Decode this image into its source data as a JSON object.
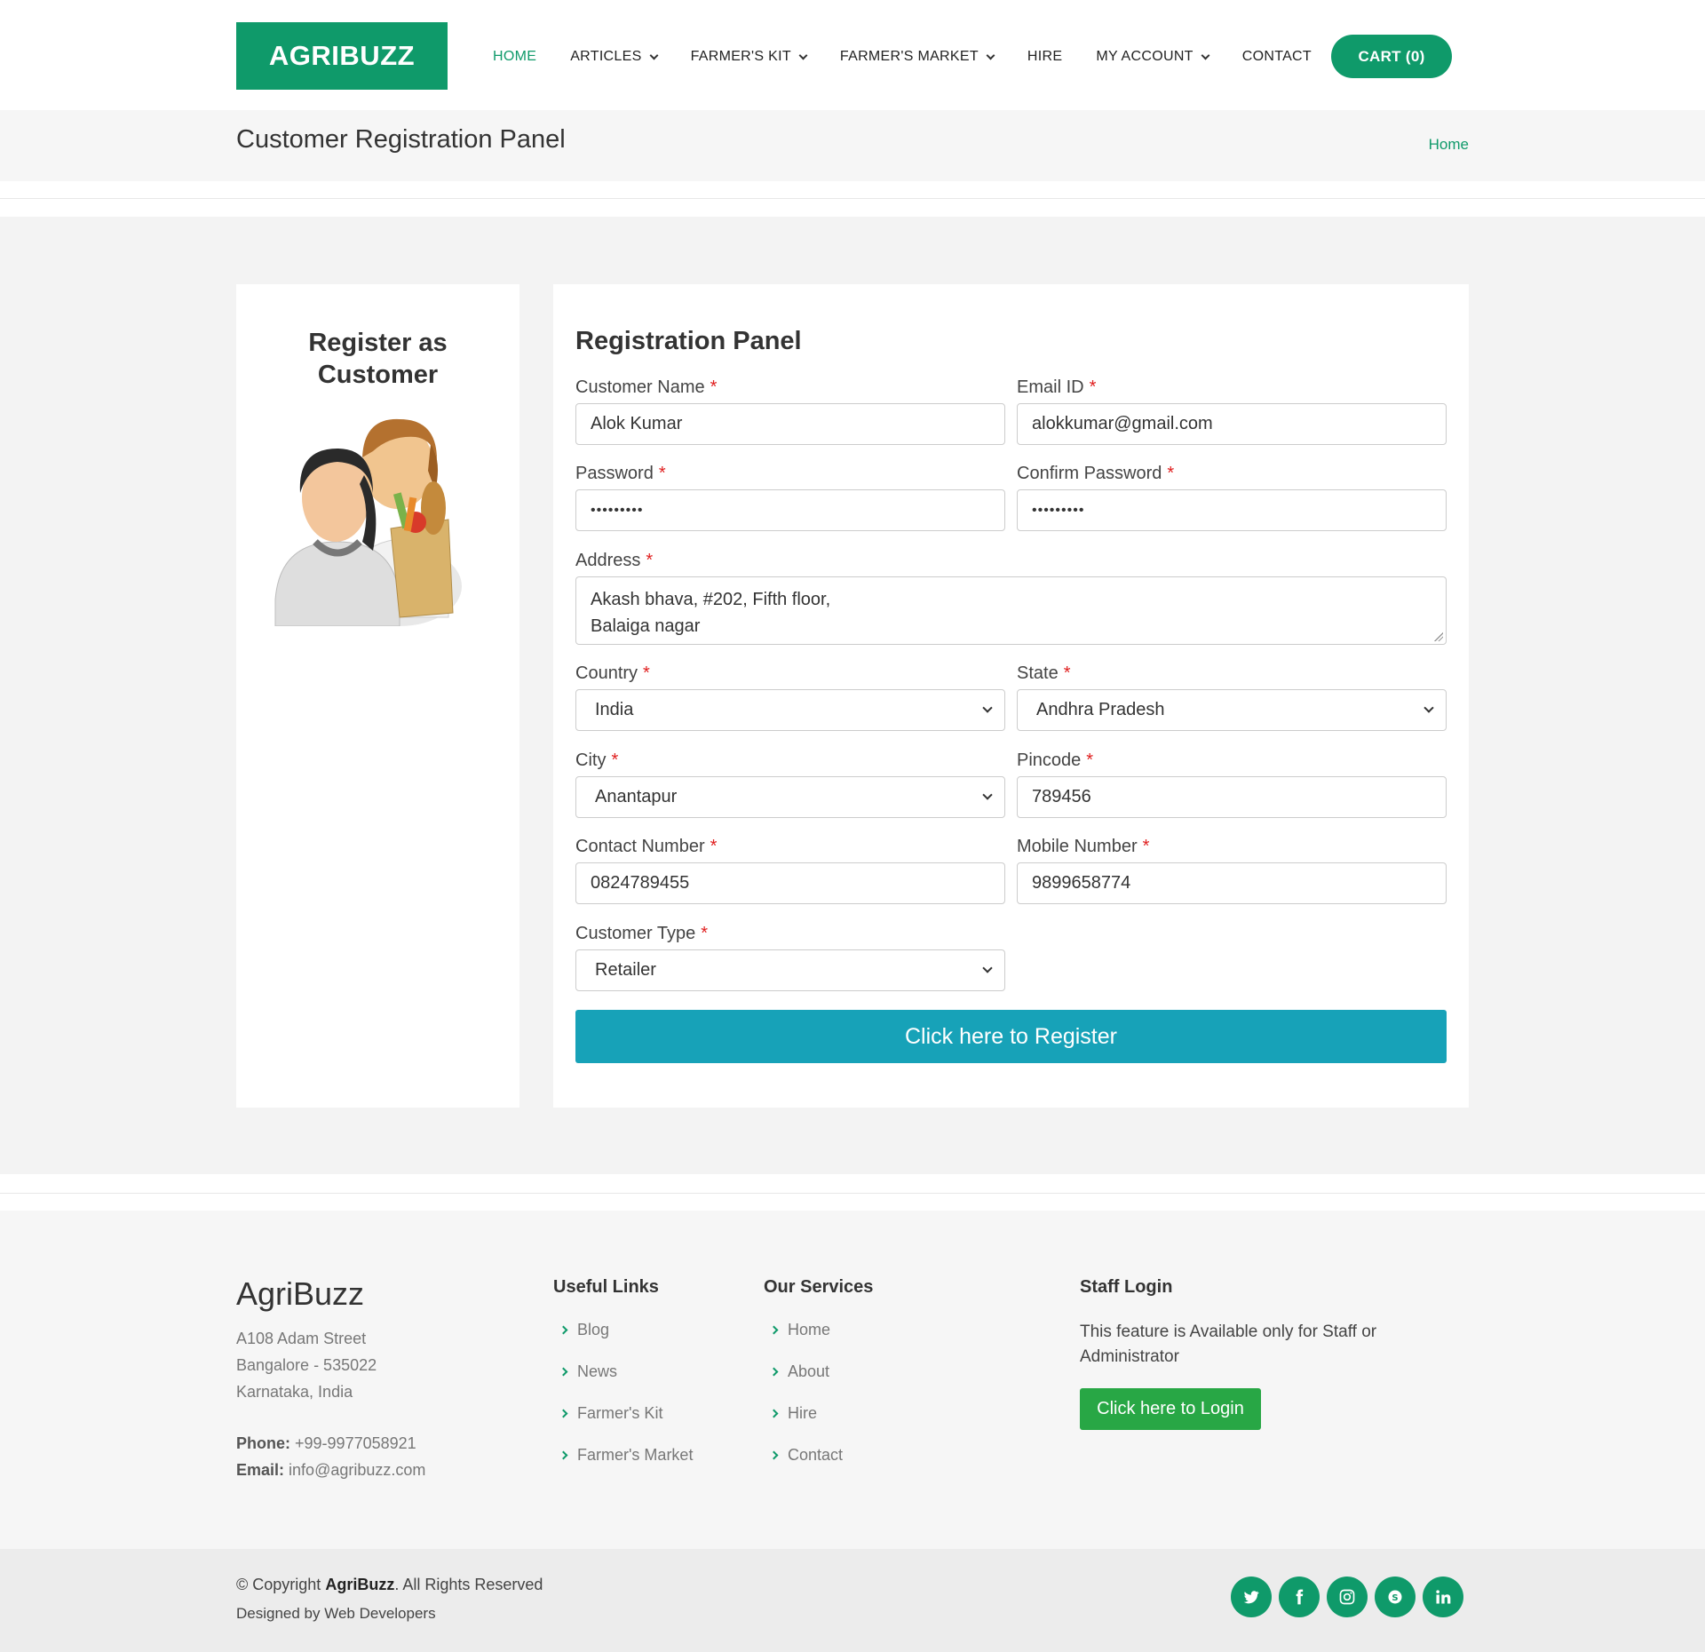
{
  "header": {
    "logo": "AGRIBUZZ",
    "nav": [
      {
        "label": "HOME",
        "active": true
      },
      {
        "label": "ARTICLES",
        "dropdown": true
      },
      {
        "label": "FARMER'S KIT",
        "dropdown": true
      },
      {
        "label": "FARMER'S MARKET",
        "dropdown": true
      },
      {
        "label": "HIRE"
      },
      {
        "label": "MY ACCOUNT",
        "dropdown": true
      },
      {
        "label": "CONTACT"
      }
    ],
    "cart": "CART (0)"
  },
  "titlebar": {
    "title": "Customer Registration Panel",
    "breadcrumb": "Home"
  },
  "side": {
    "title_line1": "Register as",
    "title_line2": "Customer",
    "image_icon": "customer-shopping-illustration"
  },
  "form": {
    "heading": "Registration Panel",
    "customer_name": {
      "label": "Customer Name",
      "value": "Alok Kumar"
    },
    "email": {
      "label": "Email ID",
      "value": "alokkumar@gmail.com"
    },
    "password": {
      "label": "Password",
      "value": "•••••••••"
    },
    "confirm_password": {
      "label": "Confirm Password",
      "value": "•••••••••"
    },
    "address": {
      "label": "Address",
      "value": "Akash bhava, #202, Fifth floor,\nBalaiga nagar"
    },
    "country": {
      "label": "Country",
      "value": "India"
    },
    "state": {
      "label": "State",
      "value": "Andhra Pradesh"
    },
    "city": {
      "label": "City",
      "value": "Anantapur"
    },
    "pincode": {
      "label": "Pincode",
      "value": "789456"
    },
    "contact_number": {
      "label": "Contact Number",
      "value": "0824789455"
    },
    "mobile_number": {
      "label": "Mobile Number",
      "value": "9899658774"
    },
    "customer_type": {
      "label": "Customer Type",
      "value": "Retailer"
    },
    "required_marker": "*",
    "submit": "Click here to Register"
  },
  "footer": {
    "brand": "AgriBuzz",
    "address_lines": [
      "A108 Adam Street",
      "Bangalore - 535022",
      "Karnataka, India"
    ],
    "phone_label": "Phone:",
    "phone": "+99-9977058921",
    "email_label": "Email:",
    "email": "info@agribuzz.com",
    "useful_links_title": "Useful Links",
    "useful_links": [
      "Blog",
      "News",
      "Farmer's Kit",
      "Farmer's Market"
    ],
    "services_title": "Our Services",
    "services": [
      "Home",
      "About",
      "Hire",
      "Contact"
    ],
    "staff_title": "Staff Login",
    "staff_text": "This feature is Available only for Staff or Administrator",
    "login_button": "Click here to Login",
    "copyright_prefix": "© Copyright",
    "copyright_brand": "AgriBuzz",
    "copyright_suffix": ". All Rights Reserved",
    "designed_by": "Designed by Web Developers",
    "socials": [
      "twitter-icon",
      "facebook-icon",
      "instagram-icon",
      "skype-icon",
      "linkedin-icon"
    ]
  },
  "colors": {
    "brand_green": "#0f9a6a",
    "register_button": "#17a2b8",
    "login_button": "#28a745",
    "required": "#e02020"
  }
}
